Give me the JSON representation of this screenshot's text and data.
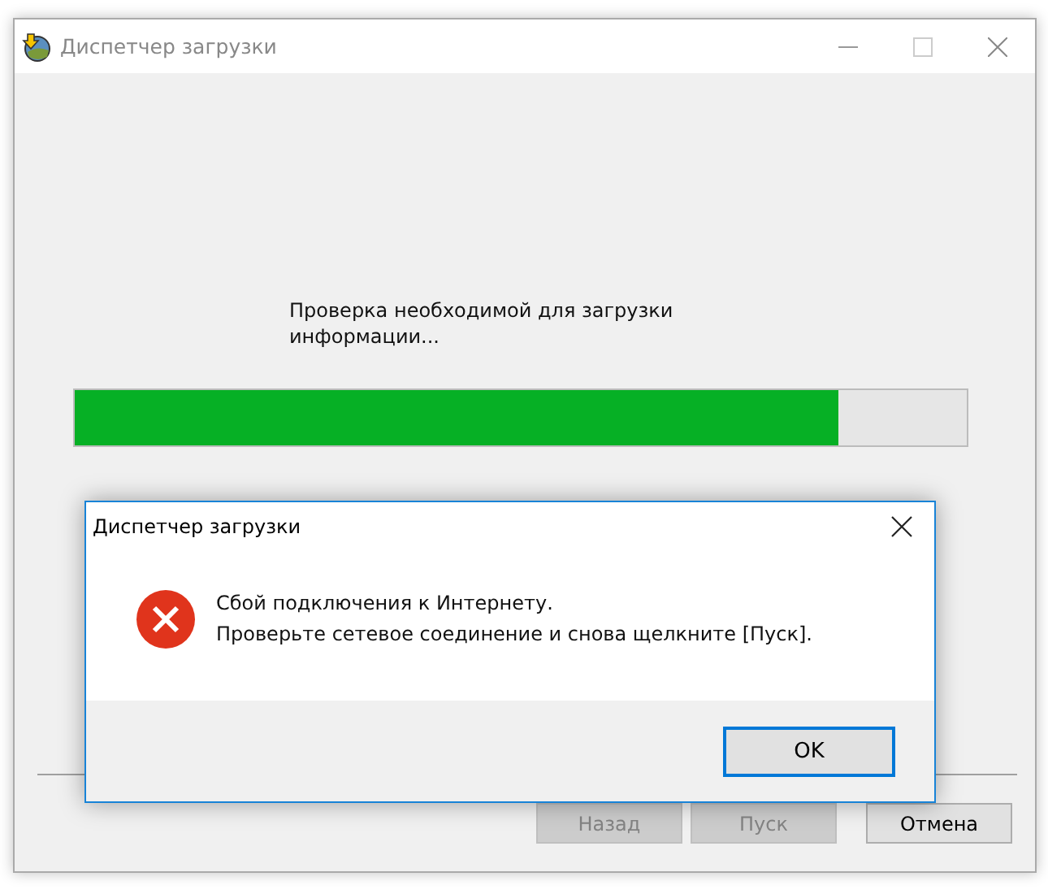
{
  "window": {
    "title": "Диспетчер загрузки"
  },
  "status_text": "Проверка необходимой для загрузки информации...",
  "progress": {
    "level": 0.856
  },
  "buttons": [
    {
      "label": "Назад",
      "disabled": true
    },
    {
      "label": "Пуск",
      "disabled": true
    },
    {
      "label": "Отмена",
      "disabled": false
    }
  ],
  "dialog": {
    "title": "Диспетчер загрузки",
    "kind": "error",
    "message": [
      "Сбой подключения к Интернету.",
      "Проверьте сетевое соединение и снова щелкните [Пуск]."
    ],
    "button": "OK"
  }
}
